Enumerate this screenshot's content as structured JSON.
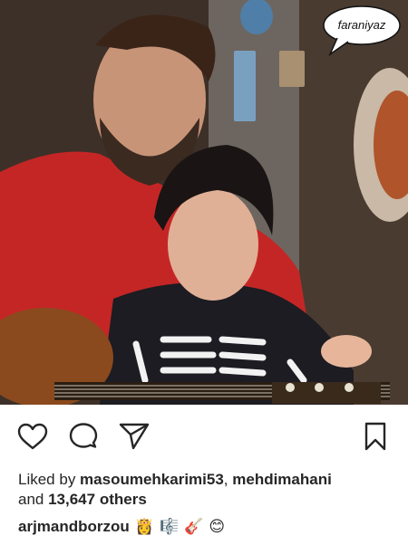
{
  "post": {
    "photo_alt": "",
    "speech_bubble_text": "faraniyaz",
    "likes": {
      "prefix": "Liked by",
      "user1": "masoumehkarimi53",
      "separator": ",",
      "user2": "mehdimahani",
      "and_text": "and",
      "others": "13,647 others"
    },
    "caption": {
      "username": "arjmandborzou",
      "emojis": [
        "👸",
        "🎼",
        "🎸",
        "😊"
      ]
    }
  },
  "icons": {
    "like": "heart-icon",
    "comment": "comment-icon",
    "share": "paper-plane-icon",
    "save": "bookmark-icon"
  }
}
